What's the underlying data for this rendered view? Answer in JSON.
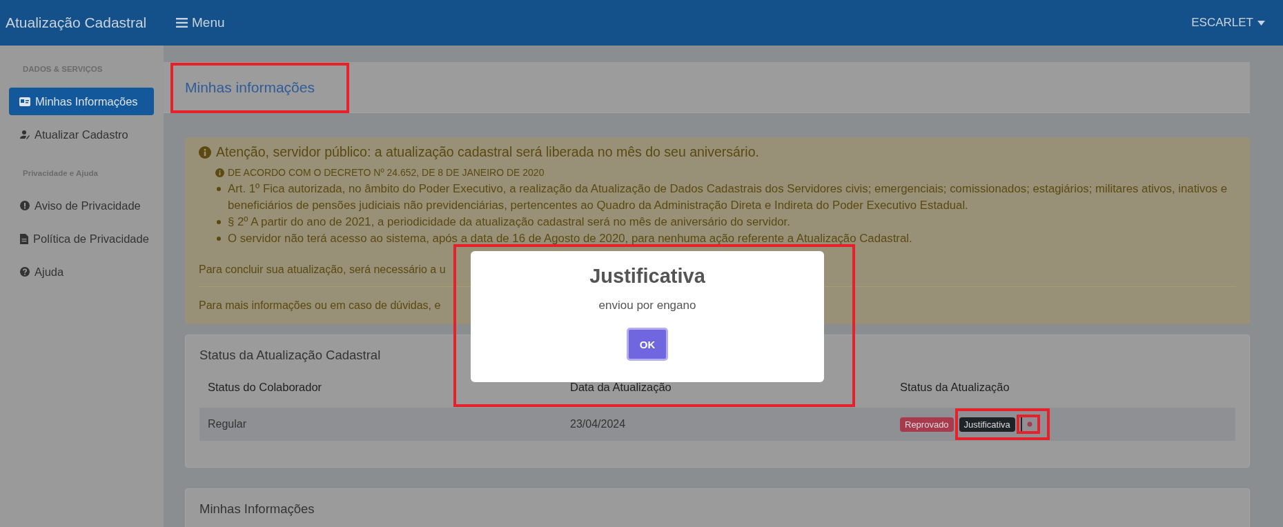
{
  "app_title": "Atualização Cadastral",
  "menu_button": {
    "label": "Menu"
  },
  "user_menu": {
    "label": "ESCARLET"
  },
  "sidebar": {
    "sections": [
      {
        "heading": "DADOS & SERVIÇOS",
        "items": [
          {
            "label": "Minhas Informações",
            "selected": true
          },
          {
            "label": "Atualizar Cadastro",
            "selected": false
          }
        ]
      },
      {
        "heading": "Privacidade e Ajuda",
        "items": [
          {
            "label": "Aviso de Privacidade",
            "selected": false
          },
          {
            "label": "Política de Privacidade",
            "selected": false
          },
          {
            "label": "Ajuda",
            "selected": false
          }
        ]
      }
    ]
  },
  "page_title": "Minhas informações",
  "alert": {
    "heading": "Atenção, servidor público: a atualização cadastral será liberada no mês do seu aniversário.",
    "decree": "DE ACORDO COM O DECRETO Nº 24.652, DE 8 DE JANEIRO DE 2020",
    "items": [
      "Art. 1º Fica autorizada, no âmbito do Poder Executivo, a realização da Atualização de Dados Cadastrais dos Servidores civis; emergenciais; comissionados; estagiários; militares ativos, inativos e beneficiários de pensões judiciais não previdenciárias, pertencentes ao Quadro da Administração Direta e Indireta do Poder Executivo Estadual.",
      "§ 2º A partir do ano de 2021, a periodicidade da atualização cadastral será no mês de aniversário do servidor.",
      "O servidor não terá acesso ao sistema, após a data de 16 de Agosto de 2020, para nenhuma ação referente a Atualização Cadastral."
    ],
    "paragraphs": [
      "Para concluir sua atualização, será necessário a u",
      "Para mais informações ou em caso de dúvidas, e"
    ]
  },
  "status_card": {
    "title": "Status da Atualização Cadastral",
    "columns": [
      "Status do Colaborador",
      "Data da Atualização",
      "Status da Atualização"
    ],
    "rows": [
      {
        "status": "Regular",
        "date": "23/04/2024",
        "badges": [
          {
            "label": "Reprovado",
            "color": "#a83a4e"
          },
          {
            "label": "Justificativa",
            "color": "#1e2328"
          }
        ]
      }
    ]
  },
  "info_card": {
    "title": "Minhas Informações"
  },
  "modal": {
    "title": "Justificativa",
    "text": "enviou por engano",
    "button": "OK"
  }
}
